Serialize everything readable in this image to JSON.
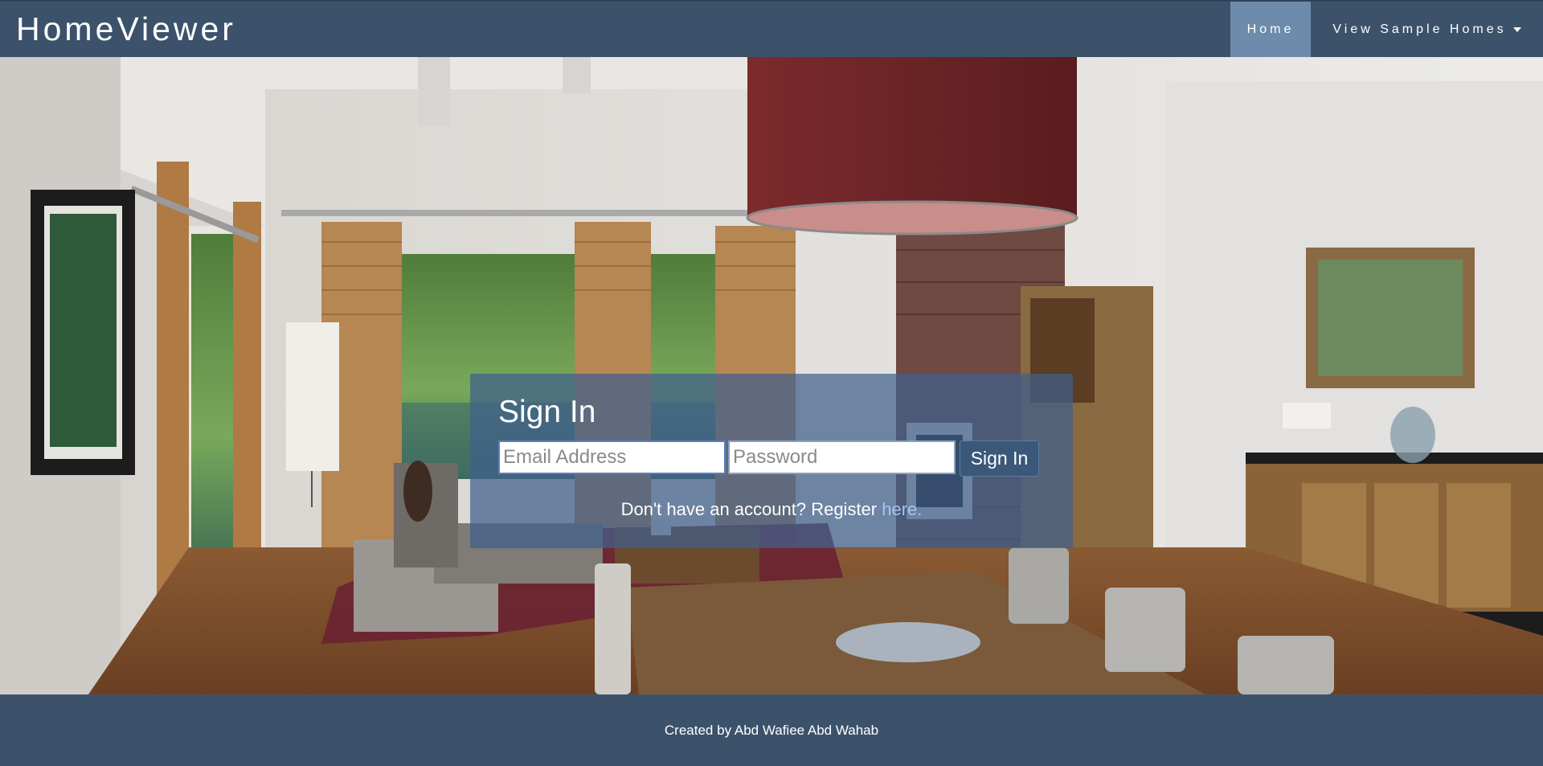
{
  "navbar": {
    "brand": "HomeViewer",
    "items": [
      {
        "label": "Home",
        "active": true
      },
      {
        "label": "View Sample Homes",
        "dropdown": true
      }
    ]
  },
  "signin": {
    "title": "Sign In",
    "email_placeholder": "Email Address",
    "email_value": "",
    "password_placeholder": "Password",
    "password_value": "",
    "button_label": "Sign In",
    "register_text": "Don't have an account? Register ",
    "register_link": "here."
  },
  "footer": {
    "text": "Created by Abd Wafiee Abd Wahab"
  },
  "colors": {
    "navbar": "#3c526b",
    "nav_active": "#6f8bab",
    "panel": "#40608c",
    "link": "#a7c5ee"
  }
}
